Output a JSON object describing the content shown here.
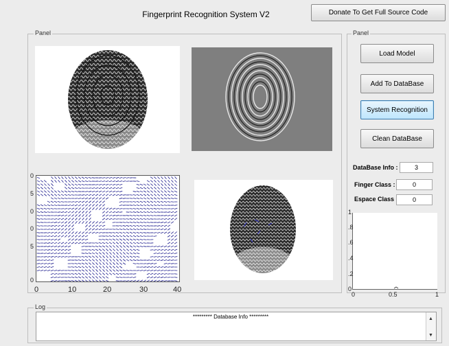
{
  "header": {
    "title": "Fingerprint Recognition System V2",
    "donate_label": "Donate To Get Full Source Code"
  },
  "left_panel": {
    "legend": "Panel"
  },
  "right_panel": {
    "legend": "Panel",
    "buttons": [
      {
        "label": "Load Model"
      },
      {
        "label": "Add To DataBase"
      },
      {
        "label": "System Recognition"
      },
      {
        "label": "Clean DataBase"
      }
    ],
    "fields": [
      {
        "label": "DataBase Info :",
        "value": "3"
      },
      {
        "label": "Finger Class :",
        "value": "0"
      },
      {
        "label": "Espace Class :",
        "value": "0"
      }
    ]
  },
  "orientation_plot": {
    "x_ticks": [
      "0",
      "10",
      "20",
      "30",
      "40"
    ],
    "y_ticks": [
      "0",
      "5",
      "0",
      "0",
      "5",
      "0"
    ]
  },
  "small_plot": {
    "y_ticks": [
      "1",
      ".8",
      ".6",
      ".4",
      ".2",
      "0"
    ],
    "x_ticks": [
      "0",
      "0.5",
      "1"
    ]
  },
  "log": {
    "legend": "Log",
    "text": "*********  Database Info  *********"
  },
  "colors": {
    "accent": "#3c7fb1",
    "field_bg": "#ffffff",
    "quiver": "#1a1a8c",
    "gray_img": "#7f7f7f"
  }
}
